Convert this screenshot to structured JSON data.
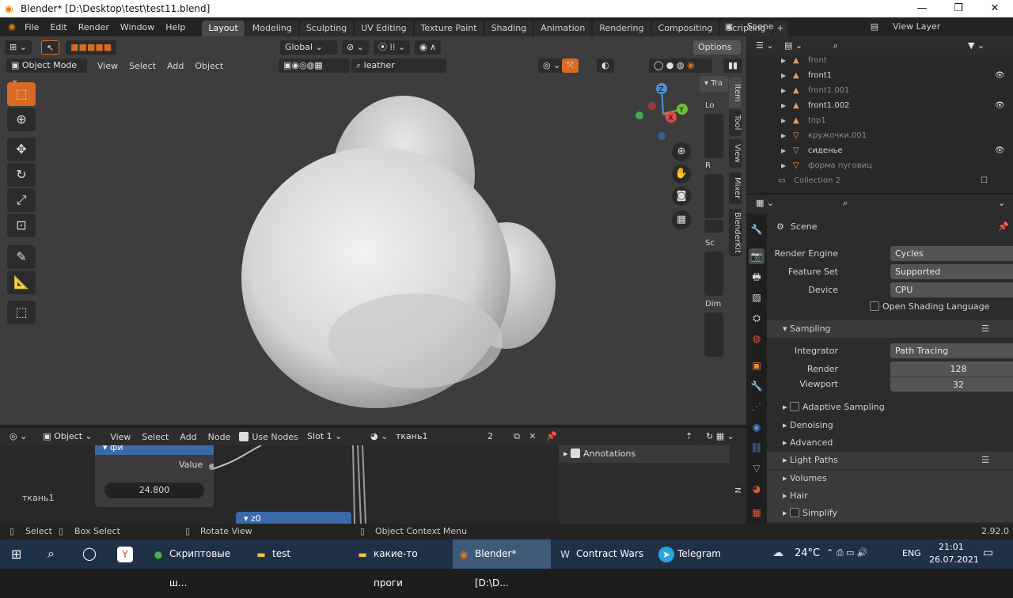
{
  "window": {
    "title": "Blender* [D:\\Desktop\\test\\test11.blend]",
    "minimize": "—",
    "maximize": "❐",
    "close": "✕"
  },
  "topbar": {
    "menus": [
      "File",
      "Edit",
      "Render",
      "Window",
      "Help"
    ],
    "tabs": [
      "Layout",
      "Modeling",
      "Sculpting",
      "UV Editing",
      "Texture Paint",
      "Shading",
      "Animation",
      "Rendering",
      "Compositing",
      "Scripting"
    ],
    "active_tab": "Layout",
    "scene": "Scene",
    "view_layer": "View Layer"
  },
  "viewport": {
    "transform_orientation": "Global",
    "options": "Options",
    "mode": "Object Mode",
    "menus": [
      "View",
      "Select",
      "Add",
      "Object"
    ],
    "material_search": "leather",
    "side_tabs": [
      "Item",
      "Tool",
      "View",
      "Mixer",
      "BlenderKit"
    ],
    "npanel_header": "Tra",
    "npanel_labels": [
      "Lo",
      "R",
      "Sc",
      "Dim"
    ],
    "gizmo": {
      "x": "X",
      "y": "Y",
      "z": "Z"
    }
  },
  "outliner": {
    "rows": [
      {
        "name": "front",
        "dim": true,
        "eye": false
      },
      {
        "name": "front1",
        "dim": false,
        "eye": true
      },
      {
        "name": "front1.001",
        "dim": true,
        "eye": false
      },
      {
        "name": "front1.002",
        "dim": false,
        "eye": true
      },
      {
        "name": "top1",
        "dim": true,
        "eye": false
      },
      {
        "name": "кружочки.001",
        "dim": true,
        "eye": false
      },
      {
        "name": "сиденье",
        "dim": false,
        "eye": true
      },
      {
        "name": "форма пуговиц",
        "dim": true,
        "eye": false
      },
      {
        "name": "Collection 2",
        "dim": true,
        "eye": false
      }
    ]
  },
  "properties": {
    "context": "Scene",
    "render_engine_label": "Render Engine",
    "render_engine": "Cycles",
    "feature_set_label": "Feature Set",
    "feature_set": "Supported",
    "device_label": "Device",
    "device": "CPU",
    "osl": "Open Shading Language",
    "sampling": "Sampling",
    "integrator_label": "Integrator",
    "integrator": "Path Tracing",
    "render_label": "Render",
    "render_samples": "128",
    "viewport_label": "Viewport",
    "viewport_samples": "32",
    "adaptive_sampling": "Adaptive Sampling",
    "denoising": "Denoising",
    "advanced": "Advanced",
    "light_paths": "Light Paths",
    "volumes": "Volumes",
    "hair": "Hair",
    "simplify": "Simplify"
  },
  "node_editor": {
    "type": "Object",
    "menus": [
      "View",
      "Select",
      "Add",
      "Node"
    ],
    "use_nodes": "Use Nodes",
    "slot": "Slot 1",
    "material": "ткань1",
    "users": "2",
    "node_title": "фи",
    "value_label": "Value",
    "value": "24.800",
    "node2_title": "z0",
    "frame_label": "ткань1",
    "annotations": "Annotations",
    "npanel_tab": "N"
  },
  "statusbar": {
    "select": "Select",
    "box_select": "Box Select",
    "rotate": "Rotate View",
    "context_menu": "Object Context Menu",
    "version": "2.92.0"
  },
  "taskbar": {
    "apps": [
      {
        "label": "",
        "icon": "Y",
        "color": "#e0322f"
      },
      {
        "label": "Скриптовые ш...",
        "icon": "●",
        "color": "#4caf50"
      },
      {
        "label": "test",
        "icon": "▬",
        "color": "#f3c23c"
      },
      {
        "label": "какие-то проги",
        "icon": "▬",
        "color": "#f3c23c"
      },
      {
        "label": "Blender* [D:\\D...",
        "icon": "◉",
        "color": "#e87d0d"
      },
      {
        "label": "Contract Wars",
        "icon": "W",
        "color": "#555555"
      },
      {
        "label": "Telegram",
        "icon": "➤",
        "color": "#2aa3e0"
      }
    ],
    "weather": "24°C",
    "lang": "ENG",
    "time": "21:01",
    "date": "26.07.2021"
  },
  "colors": {
    "accent": "#d96b24",
    "selection": "#4772b3",
    "panel": "#2c2c2c"
  }
}
